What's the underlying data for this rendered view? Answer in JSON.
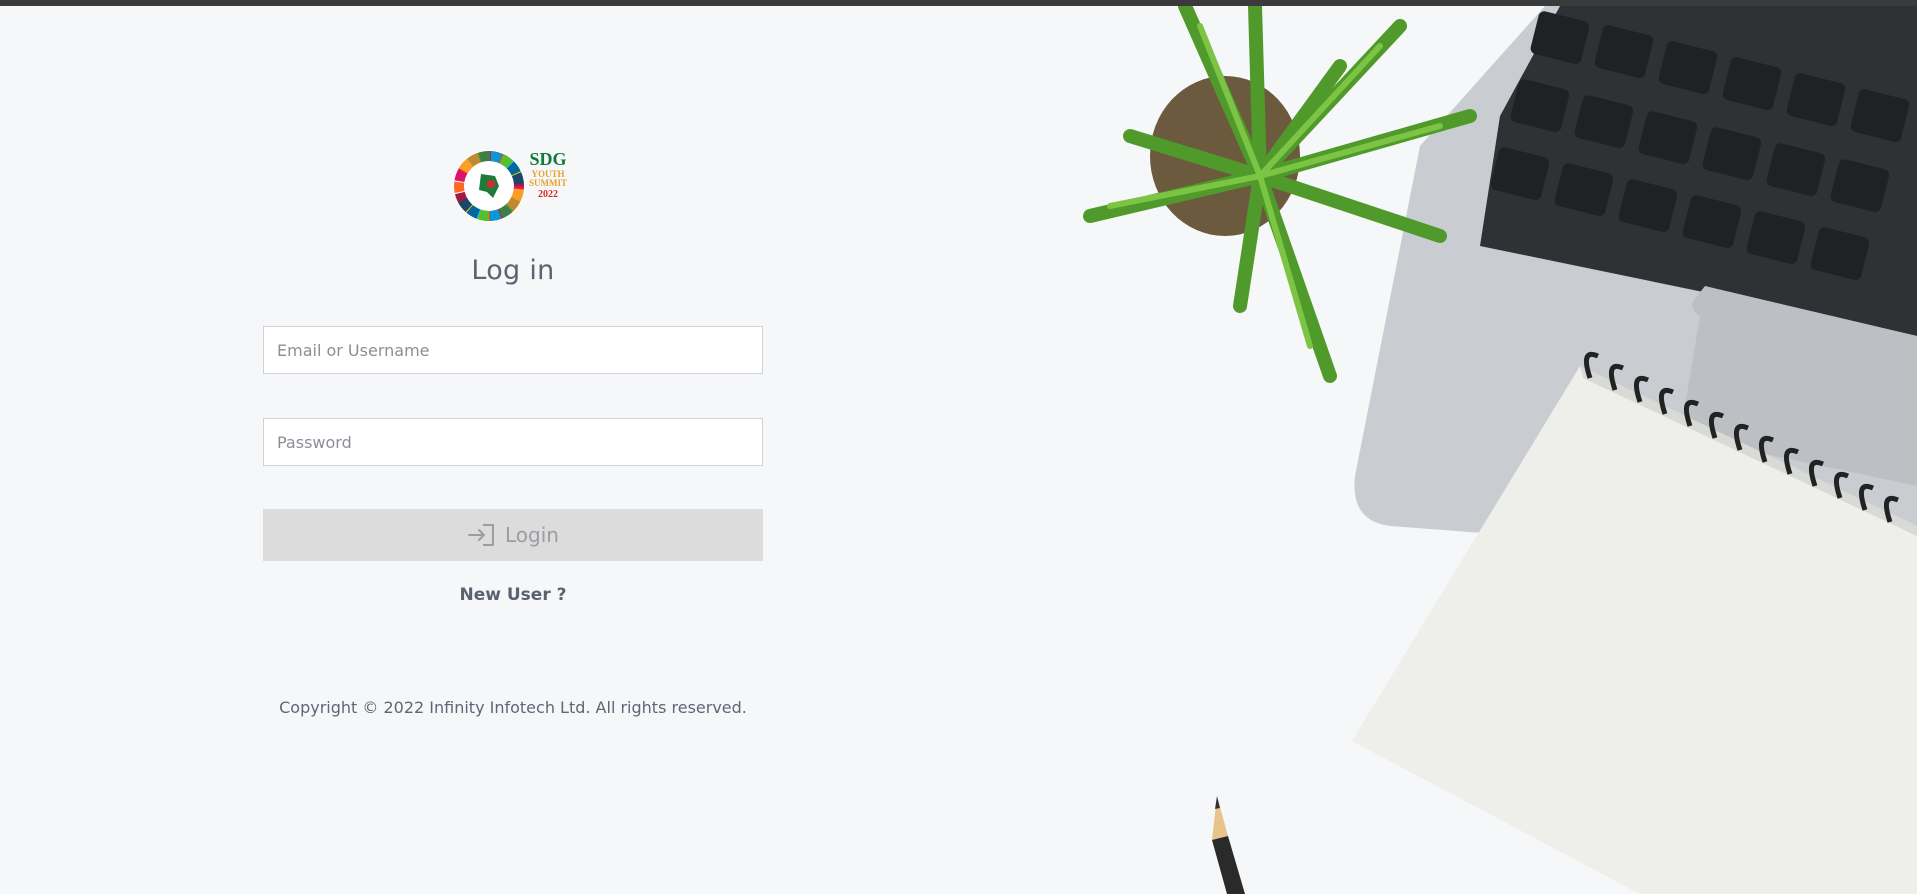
{
  "logo": {
    "line1": "SDG",
    "line2": "YOUTH",
    "line3": "SUMMIT",
    "line4": "2022"
  },
  "login": {
    "title": "Log in",
    "email_placeholder": "Email or Username",
    "password_placeholder": "Password",
    "button_label": "Login",
    "button_icon": "login-arrow-icon",
    "new_user_label": "New User ?"
  },
  "footer": {
    "copyright": "Copyright © 2022 Infinity Infotech Ltd. All rights reserved."
  },
  "colors": {
    "background": "#f6f7f8",
    "topbar": "#3a3a3a",
    "button_bg": "#dcdcdc",
    "button_text": "#9a9ea3",
    "title_text": "#5b6470"
  }
}
